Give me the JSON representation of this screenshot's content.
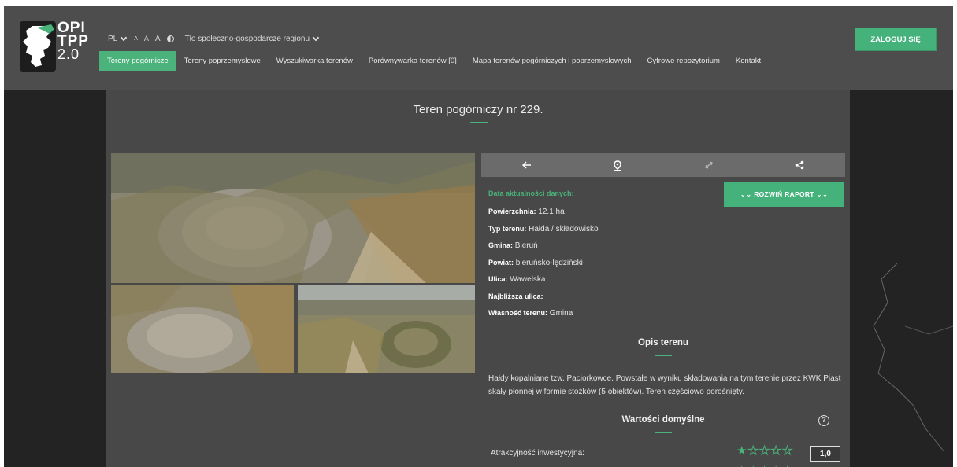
{
  "header": {
    "logo_line1": "OPI",
    "logo_line2": "TPP",
    "logo_version": "2.0",
    "language": "PL",
    "font_small": "A",
    "font_medium": "A",
    "font_large": "A",
    "socio_economic_label": "Tło społeczno-gospodarcze regionu",
    "login_label": "ZALOGUJ SIĘ"
  },
  "nav": {
    "items": [
      {
        "label": "Tereny pogórnicze",
        "active": true
      },
      {
        "label": "Tereny poprzemysłowe",
        "active": false
      },
      {
        "label": "Wyszukiwarka terenów",
        "active": false
      },
      {
        "label": "Porównywarka terenów [0]",
        "active": false
      },
      {
        "label": "Mapa terenów pogórniczych i poprzemysłowych",
        "active": false
      },
      {
        "label": "Cyfrowe repozytorium",
        "active": false
      },
      {
        "label": "Kontakt",
        "active": false
      }
    ]
  },
  "main": {
    "title": "Teren pogórniczy nr 229.",
    "report_button": "ROZWIŃ RAPORT",
    "date_label": "Data aktualności danych:",
    "details": [
      {
        "label": "Powierzchnia:",
        "value": "12.1 ha"
      },
      {
        "label": "Typ terenu:",
        "value": "Hałda / składowisko"
      },
      {
        "label": "Gmina:",
        "value": "Bieruń"
      },
      {
        "label": "Powiat:",
        "value": "bieruńsko-lędziński"
      },
      {
        "label": "Ulica:",
        "value": "Wawelska"
      },
      {
        "label": "Najbliższa ulica:",
        "value": ""
      },
      {
        "label": "Własność terenu:",
        "value": "Gmina"
      }
    ],
    "description_title": "Opis terenu",
    "description": "Hałdy kopalniane tzw. Paciorkowce. Powstałe w wyniku składowania na tym terenie przez KWK Piast skały płonnej w formie stożków (5 obiektów). Teren częściowo porośnięty.",
    "defaults_title": "Wartości domyślne",
    "help_icon": "?",
    "ratings": [
      {
        "label": "Atrakcyjność inwestycyjna:",
        "value": "1,0",
        "stars_filled": 1,
        "stars_total": 5
      }
    ]
  },
  "colors": {
    "accent": "#4ab27a",
    "header_bg": "#4d4d4d",
    "content_bg": "#484848"
  }
}
